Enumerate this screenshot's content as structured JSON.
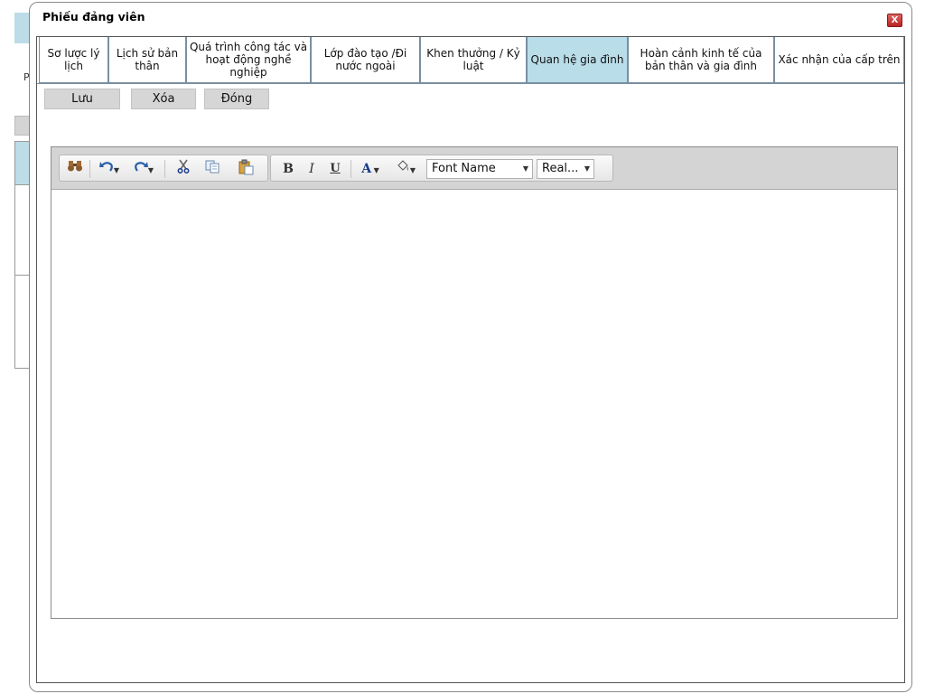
{
  "dialog": {
    "title": "Phiếu đảng viên",
    "close_label": "X"
  },
  "background": {
    "letter": "P"
  },
  "tabs": [
    {
      "label": "Sơ lược lý lịch",
      "active": false
    },
    {
      "label": "Lịch sử bản thân",
      "active": false
    },
    {
      "label": "Quá trình công tác và hoạt động nghề nghiệp",
      "active": false
    },
    {
      "label": "Lớp đào tạo /Đi nước ngoài",
      "active": false
    },
    {
      "label": "Khen thưởng / Kỷ luật",
      "active": false
    },
    {
      "label": "Quan hệ gia đình",
      "active": true
    },
    {
      "label": "Hoàn cảnh kinh tế của bản thân và gia đình",
      "active": false
    },
    {
      "label": "Xác nhận của cấp trên",
      "active": false
    }
  ],
  "actions": {
    "save_label": "Lưu",
    "delete_label": "Xóa",
    "close_label": "Đóng"
  },
  "toolbar": {
    "find_icon": "binoculars-icon",
    "undo_icon": "undo-icon",
    "redo_icon": "redo-icon",
    "cut_icon": "scissors-icon",
    "copy_icon": "copy-icon",
    "paste_icon": "paste-icon",
    "bold_label": "B",
    "italic_label": "I",
    "underline_label": "U",
    "font_color_label": "A",
    "font_name": "Font Name",
    "font_size": "Real..."
  },
  "colors": {
    "active_tab": "#b9dde9",
    "button_bg": "#d6d6d6",
    "toolbar_bg": "#d4d4d4",
    "close_button": "#c23a3a"
  }
}
